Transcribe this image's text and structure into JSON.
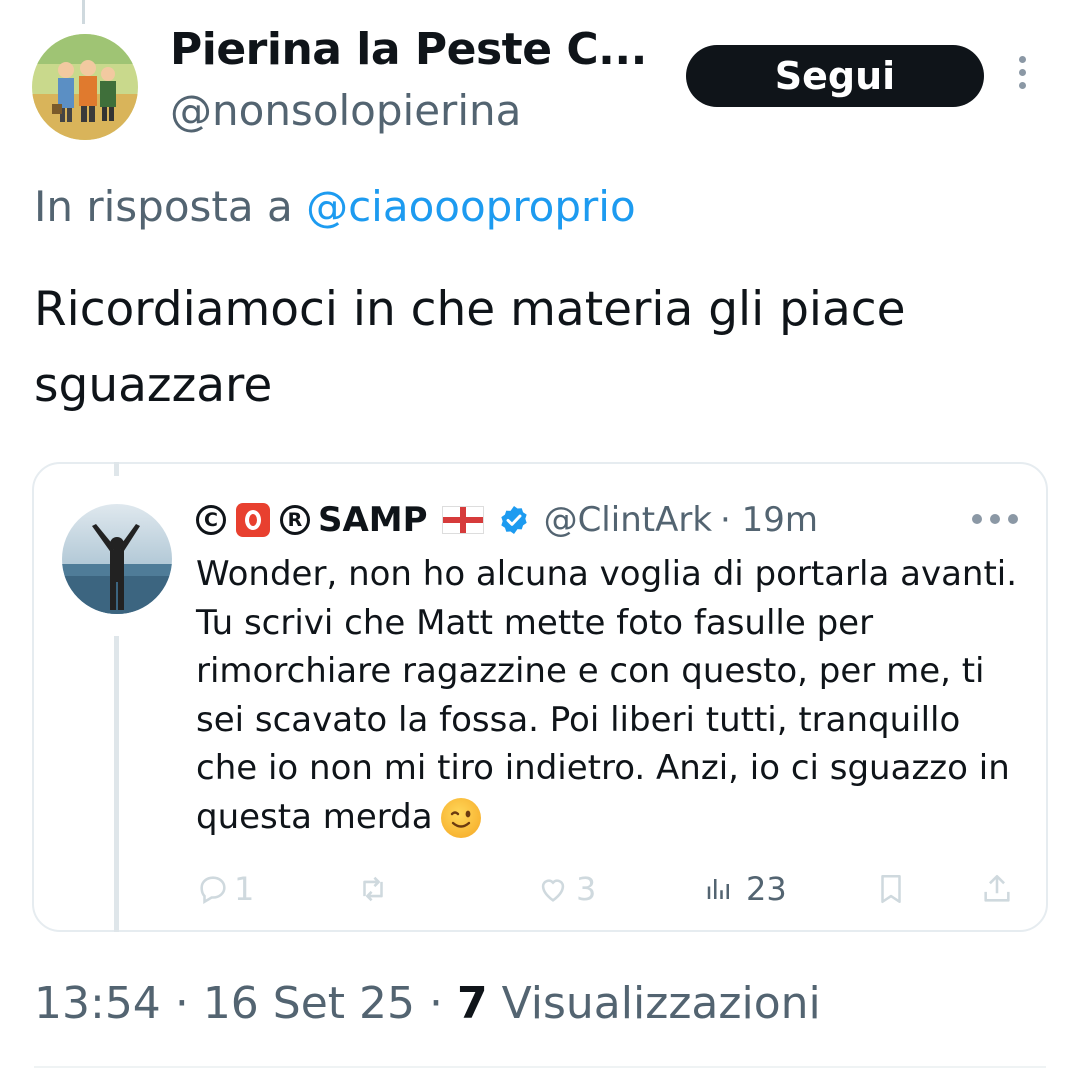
{
  "tweet": {
    "display_name": "Pierina la Peste C...",
    "handle": "@nonsolopierina",
    "follow_label": "Segui",
    "reply_prefix": "In risposta a",
    "reply_handle": "@ciaoooproprio",
    "text": "Ricordiamoci in che materia gli piace sguazzare",
    "time": "13:54",
    "separator": "·",
    "date": "16 Set 25",
    "views_count": "7",
    "views_label": "Visualizzazioni"
  },
  "quote": {
    "badge_c": "C",
    "badge_r": "R",
    "name": "SAMP",
    "handle": "@ClintArk",
    "time": "· 19m",
    "text": "Wonder, non ho alcuna voglia di portarla avanti. Tu scrivi che Matt mette foto fasulle per rimorchiare ragazzine e con questo, per me, ti sei scavato la fossa. Poi liberi tutti, tranquillo che io non mi tiro indietro. Anzi, io ci sguazzo in questa merda",
    "actions": {
      "replies": "1",
      "retweets": "",
      "likes": "3",
      "views": "23"
    }
  },
  "colors": {
    "link": "#1d9bf0",
    "secondary_text": "#536471",
    "follow_button_bg": "#0f1419",
    "verified": "#1d9bf0",
    "badge_red": "#e8402f"
  },
  "icons": [
    "more-vertical-icon",
    "verified-badge-icon",
    "flag-icon",
    "reply-icon",
    "retweet-icon",
    "like-icon",
    "views-icon",
    "bookmark-icon",
    "share-icon",
    "more-horizontal-icon",
    "wink-emoji-icon"
  ]
}
